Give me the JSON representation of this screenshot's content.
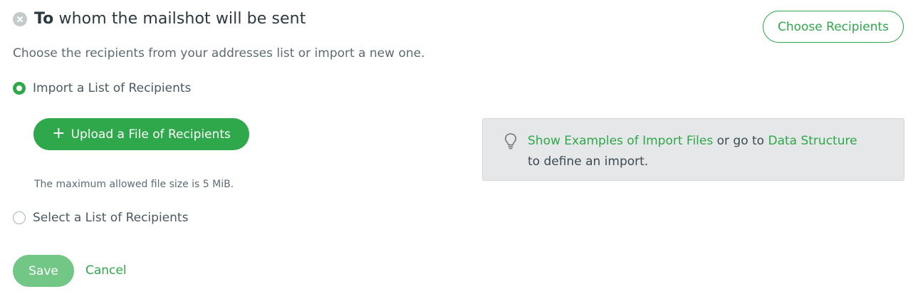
{
  "section": {
    "title_bold": "To",
    "title_rest": "whom the mailshot will be sent",
    "subtitle": "Choose the recipients from your addresses list or import a new one.",
    "choose_button": "Choose Recipients"
  },
  "options": {
    "import_label": "Import a List of Recipients",
    "import_selected": true,
    "select_label": "Select a List of Recipients",
    "select_selected": false
  },
  "upload": {
    "button_label": "Upload a File of Recipients",
    "max_size_note": "The maximum allowed file size is 5 MiB."
  },
  "hint": {
    "link_examples": "Show Examples of Import Files",
    "text_or_go_to": " or go to ",
    "link_structure": "Data Structure",
    "text_define": "to define an import."
  },
  "footer": {
    "save_label": "Save",
    "cancel_label": "Cancel"
  },
  "icons": {
    "status": "close-circle-icon",
    "plus": "plus-icon",
    "hint": "lightbulb-icon"
  },
  "colors": {
    "accent": "#2ea84a",
    "accent_disabled": "#72c686",
    "hint_bg": "#e5e7e8"
  }
}
